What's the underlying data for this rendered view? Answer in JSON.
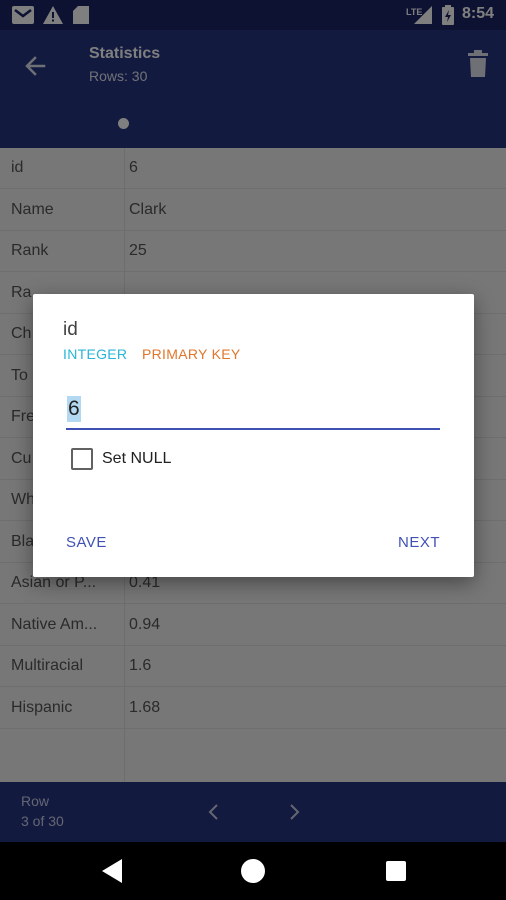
{
  "status_bar": {
    "time": "8:54",
    "network": "LTE",
    "icons": [
      "gmail-icon",
      "warning-icon",
      "sd-card-icon",
      "signal-icon",
      "battery-icon"
    ]
  },
  "app_bar": {
    "title": "Statistics",
    "subtitle": "Rows: 30",
    "back_icon": "arrow-back-icon",
    "delete_icon": "trash-icon"
  },
  "rows": [
    {
      "key": "id",
      "value": "6"
    },
    {
      "key": "Name",
      "value": "Clark"
    },
    {
      "key": "Rank",
      "value": "25"
    },
    {
      "key": "Ra",
      "value": ""
    },
    {
      "key": "Ch",
      "value": ""
    },
    {
      "key": "To",
      "value": ""
    },
    {
      "key": "Fre",
      "value": ""
    },
    {
      "key": "Cu",
      "value": ""
    },
    {
      "key": "Wh",
      "value": ""
    },
    {
      "key": "Bla",
      "value": ""
    },
    {
      "key": "Asian or P...",
      "value": "0.41"
    },
    {
      "key": "Native Am...",
      "value": "0.94"
    },
    {
      "key": "Multiracial",
      "value": "1.6"
    },
    {
      "key": "Hispanic",
      "value": "1.68"
    }
  ],
  "bottom_bar": {
    "label": "Row",
    "position": "3 of 30"
  },
  "dialog": {
    "title": "id",
    "type": "INTEGER",
    "constraint": "PRIMARY KEY",
    "value": "6",
    "checkbox_label": "Set NULL",
    "checkbox_checked": false,
    "save_label": "SAVE",
    "next_label": "NEXT"
  },
  "colors": {
    "app_bar": "#24347f",
    "status_bar": "#1a2566",
    "accent": "#3f51b5",
    "type_color": "#29b6d6",
    "constraint_color": "#e0762c"
  }
}
